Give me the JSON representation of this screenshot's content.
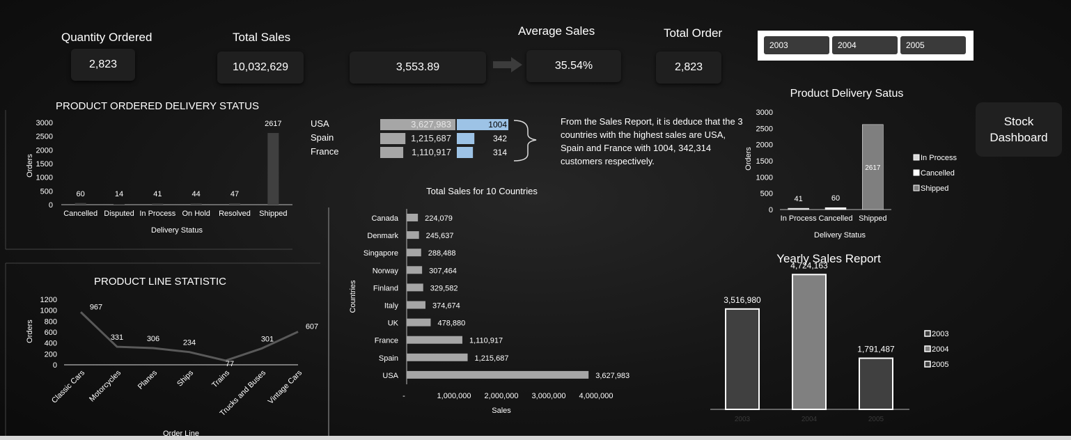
{
  "kpis": {
    "quantity_ordered": {
      "label": "Quantity Ordered",
      "value": "2,823"
    },
    "total_sales": {
      "label": "Total Sales",
      "value": "10,032,629"
    },
    "average_sales": {
      "label": "Average Sales",
      "value": "3,553.89"
    },
    "average_pct": {
      "value": "35.54%"
    },
    "total_order": {
      "label": "Total Order",
      "value": "2,823"
    }
  },
  "slicer": {
    "items": [
      "2003",
      "2004",
      "2005"
    ]
  },
  "stock_button": {
    "line1": "Stock",
    "line2": "Dashboard"
  },
  "note": {
    "text": "From the Sales Report, it is deduce that the 3  countries with the highest sales are USA, Spain and France with  1004, 342,314 customers respectively."
  },
  "top_countries": {
    "rows": [
      {
        "country": "USA",
        "sales": "3,627,983",
        "sales_value": 3627983,
        "customers": "1004",
        "customers_value": 1004
      },
      {
        "country": "Spain",
        "sales": "1,215,687",
        "sales_value": 1215687,
        "customers": "342",
        "customers_value": 342
      },
      {
        "country": "France",
        "sales": "1,110,917",
        "sales_value": 1110917,
        "customers": "314",
        "customers_value": 314
      }
    ]
  },
  "colors": {
    "bar_gray": "#a6a6a6",
    "dark_bar": "#404040",
    "blue_bar": "#9dc3e6"
  },
  "chart_data": [
    {
      "id": "delivery_status",
      "type": "bar",
      "title": "PRODUCT ORDERED DELIVERY STATUS",
      "xlabel": "Delivery Status",
      "ylabel": "Orders",
      "categories": [
        "Cancelled",
        "Disputed",
        "In Process",
        "On Hold",
        "Resolved",
        "Shipped"
      ],
      "values": [
        60,
        14,
        41,
        44,
        47,
        2617
      ],
      "yticks": [
        "3000",
        "2500",
        "2000",
        "1500",
        "1000",
        "500",
        "0"
      ],
      "ylim": [
        0,
        3000
      ]
    },
    {
      "id": "product_line",
      "type": "line",
      "title": "PRODUCT LINE STATISTIC",
      "xlabel": "Order Line",
      "ylabel": "Orders",
      "categories": [
        "Classic Cars",
        "Motorcycles",
        "Planes",
        "Ships",
        "Trains",
        "Trucks and Buses",
        "Vintage Cars"
      ],
      "values": [
        967,
        331,
        306,
        234,
        77,
        301,
        607
      ],
      "yticks": [
        "1200",
        "1000",
        "800",
        "600",
        "400",
        "200",
        "0"
      ],
      "ylim": [
        0,
        1200
      ]
    },
    {
      "id": "country_sales",
      "type": "bar",
      "orientation": "horizontal",
      "title": "Total Sales for 10 Countries",
      "xlabel": "Sales",
      "ylabel": "Countries",
      "categories": [
        "Canada",
        "Denmark",
        "Singapore",
        "Norway",
        "Finland",
        "Italy",
        "UK",
        "France",
        "Spain",
        "USA"
      ],
      "values": [
        224079,
        245637,
        288488,
        307464,
        329582,
        374674,
        478880,
        1110917,
        1215687,
        3627983
      ],
      "labels": [
        "224,079",
        "245,637",
        "288,488",
        "307,464",
        "329,582",
        "374,674",
        "478,880",
        "1,110,917",
        "1,215,687",
        "3,627,983"
      ],
      "xticks": [
        "-",
        "1,000,000",
        "2,000,000",
        "3,000,000",
        "4,000,000"
      ],
      "xlim": [
        0,
        4000000
      ]
    },
    {
      "id": "delivery_status_small",
      "type": "bar",
      "title": "Product Delivery Satus",
      "xlabel": "Delivery Status",
      "ylabel": "Orders",
      "categories": [
        "In Process",
        "Cancelled",
        "Shipped"
      ],
      "values": [
        41,
        60,
        2617
      ],
      "yticks": [
        "3000",
        "2500",
        "2000",
        "1500",
        "1000",
        "500",
        "0"
      ],
      "ylim": [
        0,
        3000
      ],
      "legend": [
        "In Process",
        "Cancelled",
        "Shipped"
      ],
      "legend_position": "right"
    },
    {
      "id": "yearly_sales",
      "type": "bar",
      "title": "Yearly Sales Report",
      "categories": [
        "2003",
        "2004",
        "2005"
      ],
      "values": [
        3516980,
        4724163,
        1791487
      ],
      "labels": [
        "3,516,980",
        "4,724,163",
        "1,791,487"
      ],
      "legend": [
        "2003",
        "2004",
        "2005"
      ],
      "legend_position": "right"
    }
  ]
}
